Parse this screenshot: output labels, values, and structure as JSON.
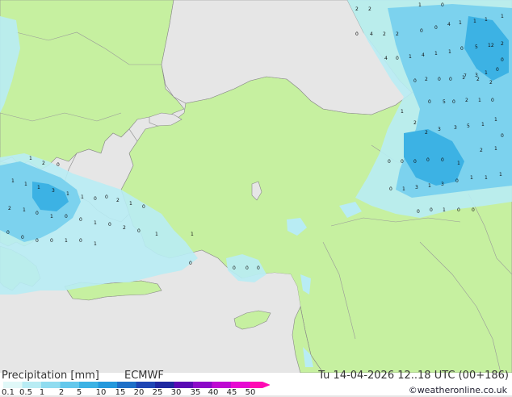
{
  "title": "Precipitation [mm]",
  "model": "ECMWF",
  "datetime": "Tu 14-04-2026 12..18 UTC (00+186)",
  "credit": "©weatheronline.co.uk",
  "legend": {
    "labels": [
      "0.1",
      "0.5",
      "1",
      "2",
      "5",
      "10",
      "15",
      "20",
      "25",
      "30",
      "35",
      "40",
      "45",
      "50"
    ],
    "colors": [
      "#e0f8f8",
      "#b8ecf4",
      "#90dcf0",
      "#64c8ec",
      "#3cb2e4",
      "#2498dc",
      "#1e70c8",
      "#1e46b4",
      "#1e28a0",
      "#5a0ab4",
      "#8c0ac8",
      "#be0ad2",
      "#e60ad2",
      "#ff0ab4"
    ]
  },
  "colors": {
    "land": "#c6f0a0",
    "sea": "#e6e6e6",
    "rain_light": "#b8ecf4",
    "rain_medium": "#7cd2ee",
    "rain_heavy": "#3cb2e4"
  },
  "map_values": [
    "2",
    "2",
    "1",
    "0",
    "0",
    "4",
    "2",
    "2",
    "0",
    "0",
    "4",
    "1",
    "1",
    "1",
    "1",
    "4",
    "0",
    "1",
    "4",
    "1",
    "1",
    "0",
    "5",
    "12",
    "2",
    "0",
    "1",
    "3",
    "7",
    "0",
    "0",
    "2",
    "0",
    "0",
    "1",
    "2",
    "2",
    "0",
    "5",
    "0",
    "2",
    "1",
    "0",
    "1",
    "2",
    "2",
    "3",
    "3",
    "5",
    "1",
    "1",
    "0",
    "0",
    "0",
    "0",
    "0",
    "0",
    "1",
    "2",
    "1",
    "0",
    "1",
    "3",
    "1",
    "3",
    "0",
    "1",
    "1",
    "1",
    "0",
    "0",
    "1",
    "0",
    "0",
    "1",
    "2",
    "0",
    "1",
    "1",
    "1",
    "3",
    "1",
    "1",
    "0",
    "0",
    "2",
    "1",
    "0",
    "2",
    "1",
    "0",
    "1",
    "0",
    "0",
    "1",
    "0",
    "2",
    "0",
    "1",
    "0",
    "0",
    "0",
    "0",
    "1",
    "0",
    "1",
    "1",
    "0",
    "0",
    "0",
    "0",
    "0",
    "0"
  ]
}
